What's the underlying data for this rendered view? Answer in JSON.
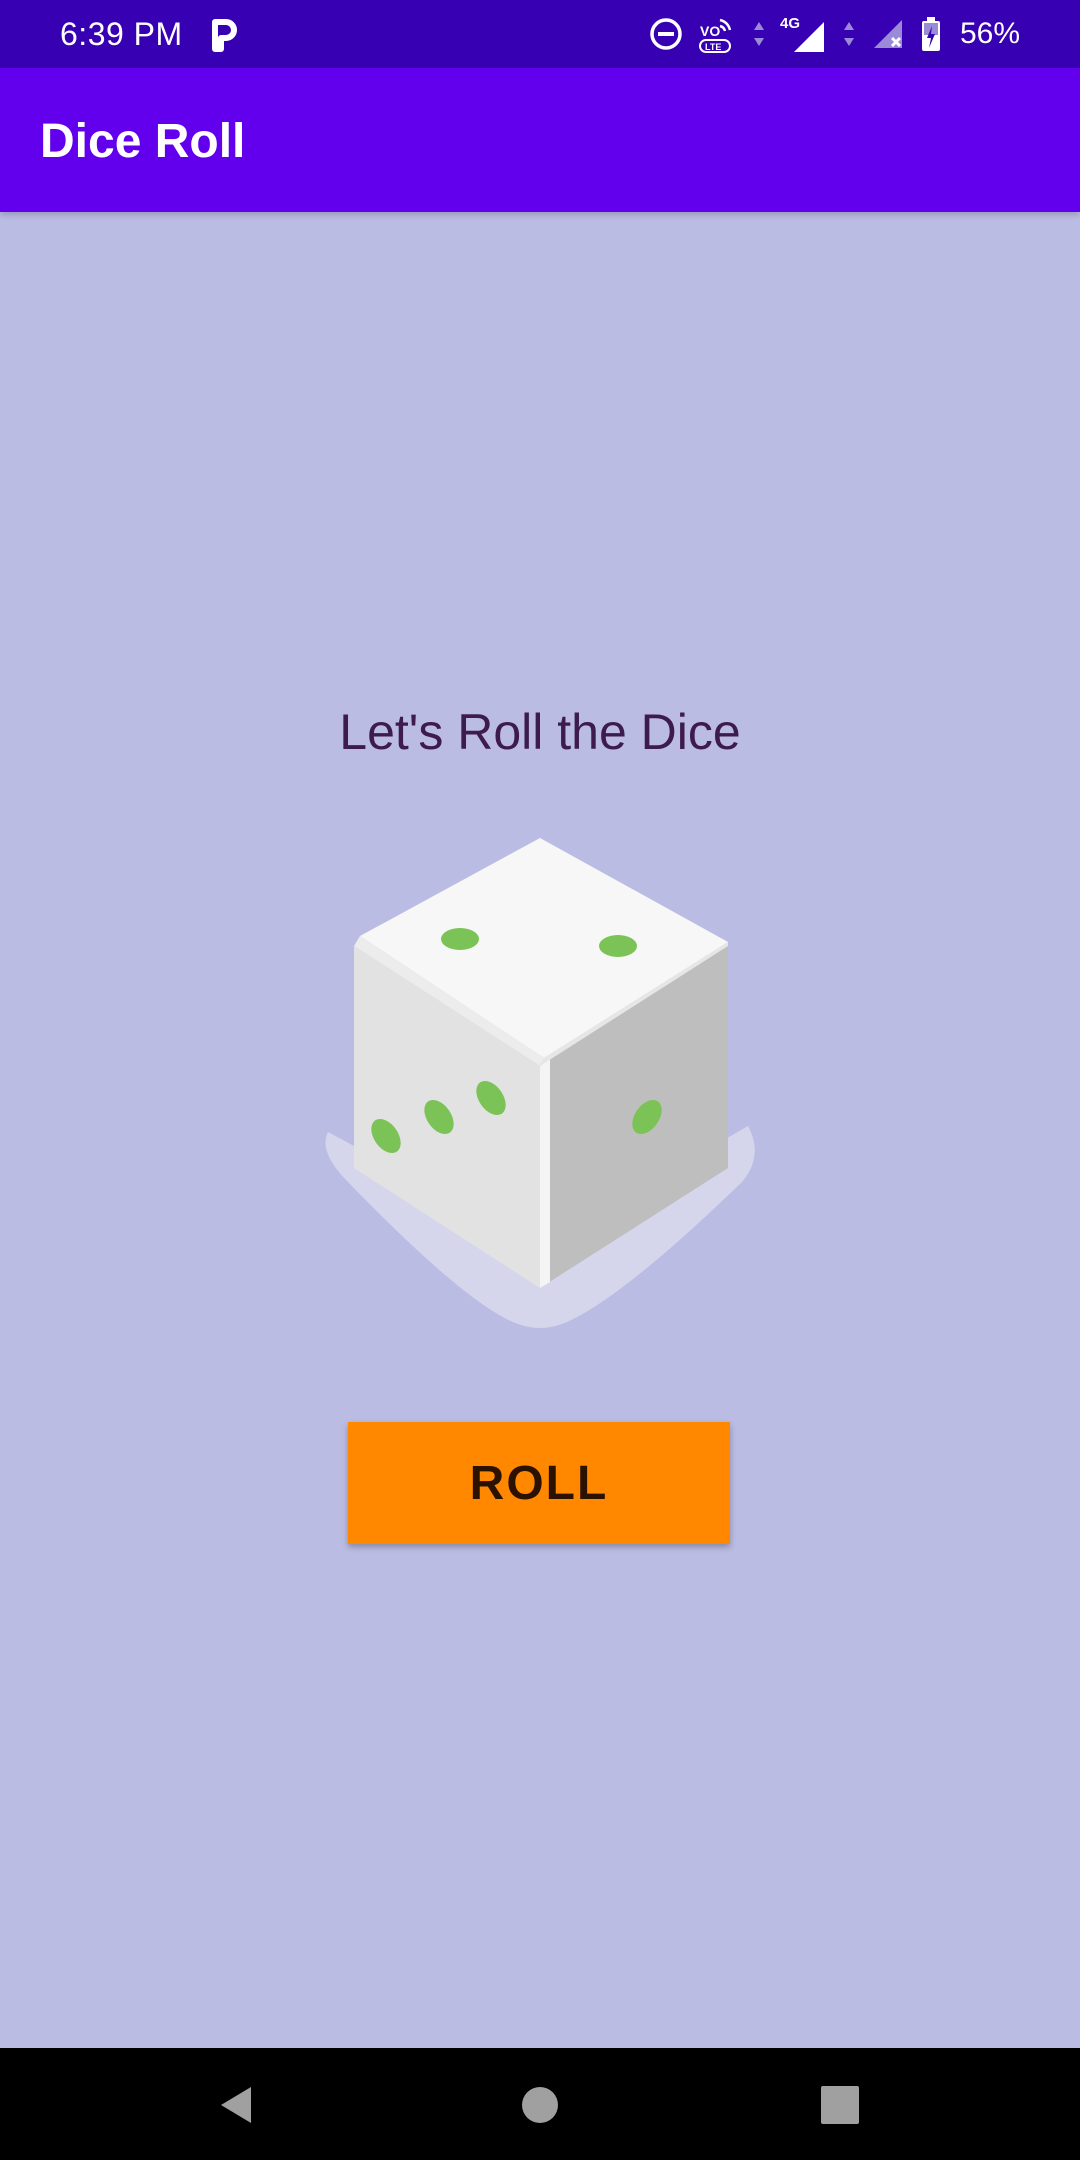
{
  "status_bar": {
    "time": "6:39 PM",
    "battery": "56%",
    "network": "4G",
    "volte": "VO LTE",
    "icons": [
      "p-app-icon",
      "do-not-disturb-icon",
      "volte-icon",
      "signal-4g-icon",
      "signal-no-service-icon",
      "battery-charging-icon"
    ]
  },
  "app_bar": {
    "title": "Dice Roll"
  },
  "main": {
    "headline": "Let's Roll the Dice",
    "dice_icon": "dice-icon",
    "roll_button_label": "ROLL"
  },
  "nav_bar": {
    "icons": [
      "back-icon",
      "home-icon",
      "recents-icon"
    ]
  },
  "colors": {
    "status_bar": "#3700b3",
    "app_bar": "#6200ee",
    "background": "#bbbce3",
    "headline_text": "#3d1a4f",
    "button": "#ff8800",
    "dice_pips": "#7bc356"
  }
}
